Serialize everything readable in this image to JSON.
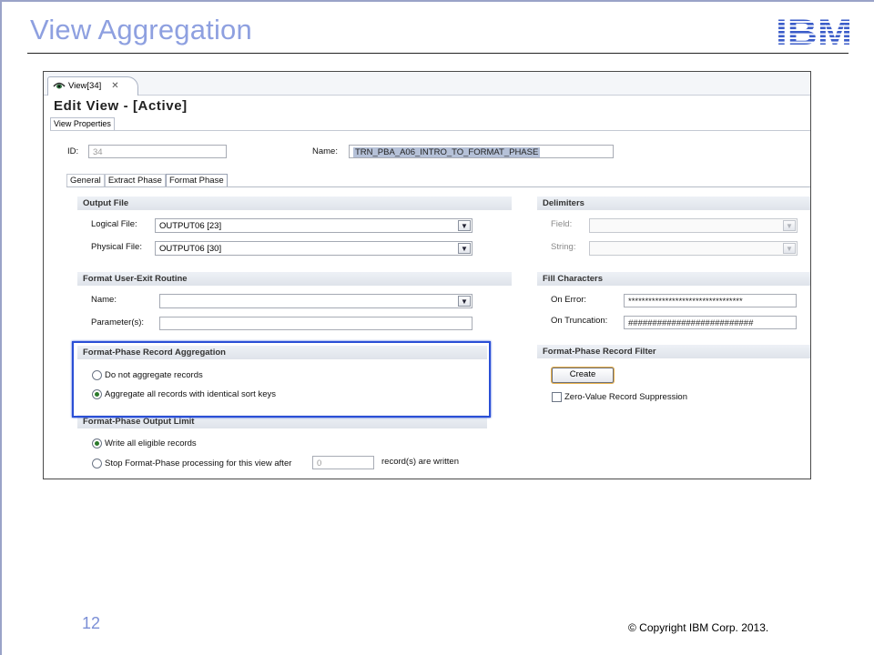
{
  "slide": {
    "title": "View Aggregation",
    "page_number": "12",
    "copyright": "© Copyright  IBM Corp. 2013.",
    "logo_text": "IBM",
    "accent_color": "#8ea0e0",
    "logo_color": "#3b5cc9"
  },
  "editor": {
    "tab_label": "View[34]",
    "tab_icon": "view-eye-icon",
    "title": "Edit View - [Active]",
    "properties_tab": "View Properties",
    "id_label": "ID:",
    "id_value": "34",
    "name_label": "Name:",
    "name_value": "TRN_PBA_A06_INTRO_TO_FORMAT_PHASE",
    "subtabs": [
      "General",
      "Extract Phase",
      "Format Phase"
    ],
    "active_subtab": "Format Phase"
  },
  "output_file": {
    "header": "Output File",
    "logical_label": "Logical File:",
    "logical_value": "OUTPUT06 [23]",
    "physical_label": "Physical File:",
    "physical_value": "OUTPUT06 [30]"
  },
  "delimiters": {
    "header": "Delimiters",
    "field_label": "Field:",
    "string_label": "String:"
  },
  "user_exit": {
    "header": "Format User-Exit Routine",
    "name_label": "Name:",
    "param_label": "Parameter(s):"
  },
  "fill_characters": {
    "header": "Fill Characters",
    "on_error_label": "On Error:",
    "on_error_value": "**********************************",
    "on_truncation_label": "On Truncation:",
    "on_truncation_value": "##########################"
  },
  "aggregation": {
    "header": "Format-Phase Record Aggregation",
    "option_none": "Do not aggregate records",
    "option_all": "Aggregate all records with identical sort keys",
    "selected": "option_all"
  },
  "record_filter": {
    "header": "Format-Phase Record Filter",
    "create_label": "Create",
    "zero_value_label": "Zero-Value Record Suppression",
    "zero_value_checked": false
  },
  "output_limit": {
    "header": "Format-Phase Output Limit",
    "option_all": "Write all eligible records",
    "option_stop": "Stop Format-Phase processing for this view after",
    "stop_value": "0",
    "stop_suffix": "record(s) are written",
    "selected": "option_all"
  },
  "highlight_color": "#2a4fd6"
}
